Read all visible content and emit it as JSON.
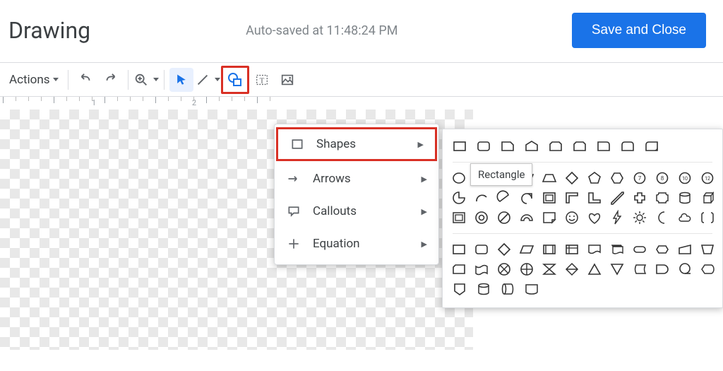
{
  "header": {
    "title": "Drawing",
    "autosave": "Auto-saved at 11:48:24 PM",
    "save_button": "Save and Close"
  },
  "toolbar": {
    "actions_label": "Actions"
  },
  "ruler": {
    "marks": [
      "1",
      "2"
    ]
  },
  "shape_menu": {
    "items": [
      {
        "label": "Shapes"
      },
      {
        "label": "Arrows"
      },
      {
        "label": "Callouts"
      },
      {
        "label": "Equation"
      }
    ]
  },
  "tooltip": {
    "first_shape": "Rectangle"
  },
  "palette": {
    "group1_row1": [
      "rect",
      "roundrect",
      "snip1",
      "home",
      "snip2",
      "snip3",
      "hex-top",
      "flag",
      "cutcorner"
    ],
    "group2_row1": [
      "circle",
      "triangle",
      "rtriangle",
      "parallelogram",
      "trapezoid",
      "diamond",
      "pentagon",
      "hexagon",
      "heptagon",
      "octagon",
      "decagon",
      "dodecagon"
    ],
    "group2_row2": [
      "pie",
      "arc",
      "blob",
      "tear",
      "frame",
      "lshape",
      "corner",
      "slant",
      "cross",
      "cylinder",
      "cube",
      "bevel"
    ],
    "group2_row3": [
      "roundsquare",
      "donut",
      "noentry",
      "arch",
      "folded",
      "smiley",
      "heart",
      "lightning",
      "sun",
      "moon",
      "cloud",
      "doublebracket"
    ],
    "group3_row1": [
      "rect2",
      "roundrect2",
      "diamond2",
      "parallelogram2",
      "stack",
      "card",
      "drum",
      "multi",
      "pill",
      "hexagon2",
      "trapdown",
      "trapup"
    ],
    "group3_row2": [
      "rect3",
      "square",
      "band",
      "circle-x",
      "circle-plus",
      "triangle2",
      "pentagon-up",
      "hexflat",
      "trianglert",
      "trigdown",
      "display",
      "or"
    ],
    "group3_row3": [
      "tab",
      "drum2",
      "ovaloverlap",
      "seq"
    ]
  }
}
